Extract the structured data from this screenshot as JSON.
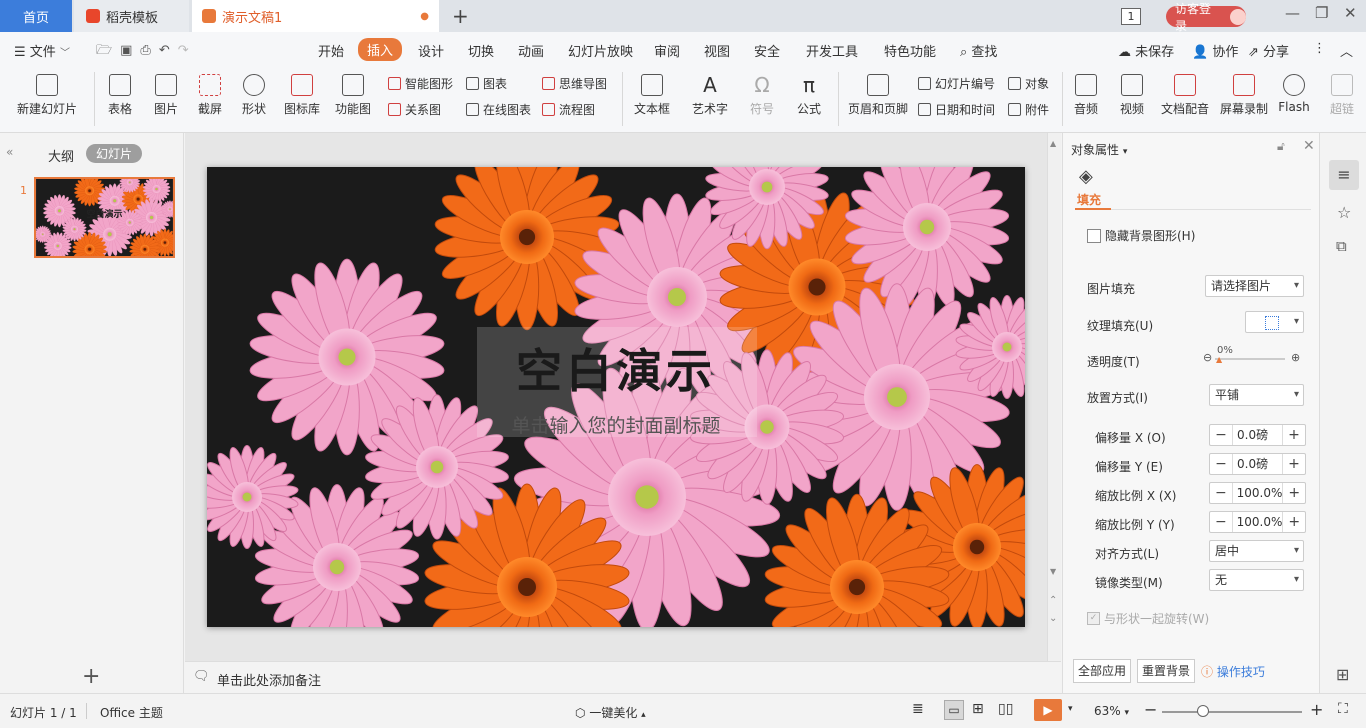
{
  "tabs": {
    "home": "首页",
    "template": "稻壳模板",
    "document": "演示文稿1",
    "window_count": "1",
    "login": "访客登录"
  },
  "menu": {
    "file": "文件",
    "items": [
      "开始",
      "插入",
      "设计",
      "切换",
      "动画",
      "幻灯片放映",
      "审阅",
      "视图",
      "安全",
      "开发工具",
      "特色功能"
    ],
    "search": "查找",
    "unsaved": "未保存",
    "collaborate": "协作",
    "share": "分享"
  },
  "ribbon": {
    "new_slide": "新建幻灯片",
    "table": "表格",
    "picture": "图片",
    "screenshot": "截屏",
    "shape": "形状",
    "icon_lib": "图标库",
    "func_chart": "功能图",
    "smart_shape": "智能图形",
    "relation": "关系图",
    "chart": "图表",
    "online_chart": "在线图表",
    "mindmap": "思维导图",
    "flowchart": "流程图",
    "textbox": "文本框",
    "wordart": "艺术字",
    "symbol": "符号",
    "formula": "公式",
    "header_footer": "页眉和页脚",
    "slide_number": "幻灯片编号",
    "datetime": "日期和时间",
    "object": "对象",
    "attachment": "附件",
    "audio": "音频",
    "video": "视频",
    "text_dub": "文档配音",
    "screen_record": "屏幕录制",
    "flash": "Flash",
    "hyperlink": "超链"
  },
  "left_panel": {
    "outline": "大纲",
    "slides": "幻灯片",
    "slide_num": "1",
    "thumb_title": "空白演示"
  },
  "slide": {
    "title": "空白演示",
    "subtitle": "单击输入您的封面副标题"
  },
  "notes": {
    "placeholder": "单击此处添加备注"
  },
  "props": {
    "header": "对象属性",
    "fill_tab": "填充",
    "hide_bg": "隐藏背景图形(H)",
    "picture_fill_label": "图片填充",
    "picture_fill_value": "请选择图片",
    "texture_fill_label": "纹理填充(U)",
    "transparency_label": "透明度(T)",
    "transparency_value": "0%",
    "placement_label": "放置方式(I)",
    "placement_value": "平铺",
    "offset_x_label": "偏移量 X (O)",
    "offset_x_value": "0.0磅",
    "offset_y_label": "偏移量 Y (E)",
    "offset_y_value": "0.0磅",
    "scale_x_label": "缩放比例 X (X)",
    "scale_x_value": "100.0%",
    "scale_y_label": "缩放比例 Y (Y)",
    "scale_y_value": "100.0%",
    "align_label": "对齐方式(L)",
    "align_value": "居中",
    "mirror_label": "镜像类型(M)",
    "mirror_value": "无",
    "rotate_with_shape": "与形状一起旋转(W)",
    "apply_all": "全部应用",
    "reset_bg": "重置背景",
    "tips": "操作技巧"
  },
  "status": {
    "slide_pos": "幻灯片 1 / 1",
    "theme": "Office 主题",
    "beautify": "一键美化",
    "zoom": "63%"
  },
  "colors": {
    "accent": "#e8793b",
    "home_tab": "#3c7ddb",
    "login": "#d9534f"
  }
}
